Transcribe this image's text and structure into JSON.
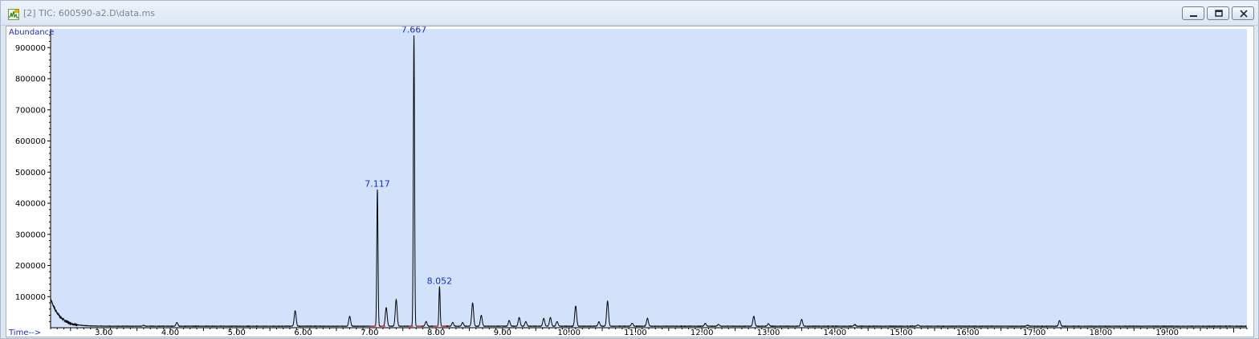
{
  "window": {
    "title": "[2] TIC: 600590-a2.D\\data.ms",
    "icon": "chromatogram-app-icon"
  },
  "controls": {
    "minimize_icon": "minimize-icon",
    "restore_icon": "restore-icon",
    "close_icon": "close-icon"
  },
  "colors": {
    "plot_bg": "#d3e2fb",
    "trace": "#000000",
    "label": "#1a2ecf",
    "baseline_marks": "#e23b3b"
  },
  "chart_data": {
    "type": "line",
    "ylabel": "Abundance",
    "xlabel": "Time-->",
    "xlim": [
      2.2,
      20.2
    ],
    "ylim": [
      0,
      960000
    ],
    "x_ticks": [
      3.0,
      4.0,
      5.0,
      6.0,
      7.0,
      8.0,
      9.0,
      10.0,
      11.0,
      12.0,
      13.0,
      14.0,
      15.0,
      16.0,
      17.0,
      18.0,
      19.0
    ],
    "x_tick_labels": [
      "3.00",
      "4.00",
      "5.00",
      "6.00",
      "7.00",
      "8.00",
      "9.00",
      "10.00",
      "11.00",
      "12.00",
      "13.00",
      "14.00",
      "15.00",
      "16.00",
      "17.00",
      "18.00",
      "19.00"
    ],
    "y_ticks": [
      100000,
      200000,
      300000,
      400000,
      500000,
      600000,
      700000,
      800000,
      900000
    ],
    "y_tick_labels": [
      "100000",
      "200000",
      "300000",
      "400000",
      "500000",
      "600000",
      "700000",
      "800000",
      "900000"
    ],
    "baseline": {
      "start_value": 95000,
      "decay_to": 5000,
      "decay_rate": 7.5,
      "late_value": 4000
    },
    "peaks": [
      {
        "rt": 3.6,
        "height": 3000
      },
      {
        "rt": 4.1,
        "height": 12000
      },
      {
        "rt": 5.88,
        "height": 50000
      },
      {
        "rt": 6.7,
        "height": 32000
      },
      {
        "rt": 7.117,
        "height": 440000
      },
      {
        "rt": 7.25,
        "height": 60000
      },
      {
        "rt": 7.4,
        "height": 85000
      },
      {
        "rt": 7.667,
        "height": 935000
      },
      {
        "rt": 7.85,
        "height": 15000
      },
      {
        "rt": 8.052,
        "height": 128000
      },
      {
        "rt": 8.25,
        "height": 12000
      },
      {
        "rt": 8.4,
        "height": 12000
      },
      {
        "rt": 8.55,
        "height": 75000
      },
      {
        "rt": 8.68,
        "height": 35000
      },
      {
        "rt": 9.1,
        "height": 18000
      },
      {
        "rt": 9.25,
        "height": 28000
      },
      {
        "rt": 9.35,
        "height": 15000
      },
      {
        "rt": 9.62,
        "height": 25000
      },
      {
        "rt": 9.72,
        "height": 28000
      },
      {
        "rt": 9.82,
        "height": 15000
      },
      {
        "rt": 10.1,
        "height": 65000
      },
      {
        "rt": 10.45,
        "height": 14000
      },
      {
        "rt": 10.58,
        "height": 80000
      },
      {
        "rt": 10.95,
        "height": 10000
      },
      {
        "rt": 11.18,
        "height": 25000
      },
      {
        "rt": 12.05,
        "height": 9000
      },
      {
        "rt": 12.25,
        "height": 6000
      },
      {
        "rt": 12.78,
        "height": 32000
      },
      {
        "rt": 13.0,
        "height": 8000
      },
      {
        "rt": 13.5,
        "height": 22000
      },
      {
        "rt": 14.3,
        "height": 5000
      },
      {
        "rt": 15.25,
        "height": 4000
      },
      {
        "rt": 16.9,
        "height": 3000
      },
      {
        "rt": 17.38,
        "height": 18000
      }
    ],
    "labeled_peaks": [
      {
        "label": "7.117",
        "rt": 7.117,
        "height": 440000
      },
      {
        "label": "7.667",
        "rt": 7.667,
        "height": 935000
      },
      {
        "label": "8.052",
        "rt": 8.052,
        "height": 128000
      }
    ],
    "baseline_markers": [
      7.05,
      7.2,
      7.62,
      7.74,
      8.0,
      8.12
    ]
  }
}
